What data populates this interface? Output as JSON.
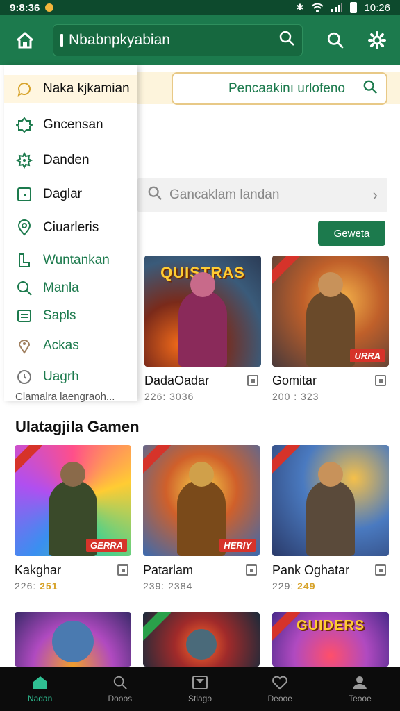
{
  "status_bar": {
    "time_left": "9:8:36",
    "time_right": "10:26"
  },
  "app_bar": {
    "search_value": "Nbabnpkyabian"
  },
  "promo": {
    "search_label": "Pencaakinı urlofeno"
  },
  "search_bar": {
    "placeholder": "Gancaklam landan"
  },
  "action_button": {
    "label": "Geweta"
  },
  "drawer": {
    "items": [
      {
        "label": "Naka kjkamian",
        "icon": "chat-icon"
      },
      {
        "label": "Gncensan",
        "icon": "puzzle-icon"
      },
      {
        "label": "Danden",
        "icon": "gear-icon"
      },
      {
        "label": "Daglar",
        "icon": "calendar-icon"
      },
      {
        "label": "Ciuarleris",
        "icon": "location-pin-icon"
      },
      {
        "label": "Wuntankan",
        "icon": "bookmark-icon"
      },
      {
        "label": "Manla",
        "icon": "search-icon"
      },
      {
        "label": "Sapls",
        "icon": "list-icon"
      },
      {
        "label": "Ackas",
        "icon": "pin-icon"
      },
      {
        "label": "Uagrh",
        "icon": "clock-icon"
      }
    ],
    "footer": "Clamalra laengraoh..."
  },
  "featured_games": [
    {
      "name": "DadaOadar",
      "sub": "226: 3036",
      "thumb_title": "QUISTRAS",
      "badge": ""
    },
    {
      "name": "Gomitar",
      "sub": "200 : 323",
      "thumb_title": "",
      "badge": "URRA"
    }
  ],
  "section": {
    "title": "Ulatagjila Gamen"
  },
  "games": [
    {
      "name": "Kakghar",
      "sub": "226:",
      "sub_highlight": "251",
      "badge": "GERRA"
    },
    {
      "name": "Patarlam",
      "sub": "239: 2384",
      "sub_highlight": "",
      "badge": "HERIY"
    },
    {
      "name": "Pank Oghatar",
      "sub": "229:",
      "sub_highlight": "249",
      "badge": ""
    }
  ],
  "bottom_row_games": [
    {
      "thumb_title": ""
    },
    {
      "thumb_title": ""
    },
    {
      "thumb_title": "GUIDERS"
    }
  ],
  "bottom_nav": [
    {
      "label": "Nadan",
      "icon": "home-icon"
    },
    {
      "label": "Dooos",
      "icon": "search-icon"
    },
    {
      "label": "Stiago",
      "icon": "inbox-icon"
    },
    {
      "label": "Deooe",
      "icon": "heart-icon"
    },
    {
      "label": "Teooe",
      "icon": "profile-icon"
    }
  ],
  "colors": {
    "primary": "#1c7a4d",
    "status_bar": "#0d4a2d",
    "accent_gold": "#d7a32b",
    "badge_red": "#d6332a",
    "nav_active": "#2fc093"
  }
}
